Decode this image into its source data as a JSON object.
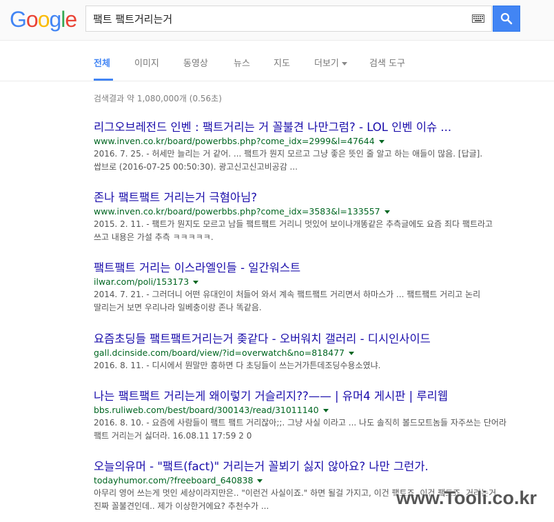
{
  "logo": {
    "letters": [
      "G",
      "o",
      "o",
      "g",
      "l",
      "e"
    ],
    "colors": [
      "#4285f4",
      "#ea4335",
      "#fbbc05",
      "#4285f4",
      "#34a853",
      "#ea4335"
    ]
  },
  "search": {
    "query": "퍀트 퍀트거리는거"
  },
  "tabs": [
    {
      "label": "전체",
      "active": true
    },
    {
      "label": "이미지"
    },
    {
      "label": "동영상"
    },
    {
      "label": "뉴스"
    },
    {
      "label": "지도"
    },
    {
      "label": "더보기"
    },
    {
      "label": "검색 도구"
    }
  ],
  "stats": "검색결과 약 1,080,000개 (0.56초)",
  "results": [
    {
      "title": "리그오브레전드 인벤 : 퍀트거리는 거 꼴불견 나만그럼? - LOL 인벤 이슈 ...",
      "url": "www.inven.co.kr/board/powerbbs.php?come_idx=2999&l=47644",
      "snippet": "2016. 7. 25. - 허세만 늘리는 거 같어. ... 퍀트가 뭔지 모르고 그냥 좋은 뜻인 줄 알고 하는 애들이 많음. [답글]. 쌉브로 (2016-07-25 00:50:30). 광고신고신고비공감 ..."
    },
    {
      "title": "존나 퍀트퍀트 거리는거 극혐아님?",
      "url": "www.inven.co.kr/board/powerbbs.php?come_idx=3583&l=133557",
      "snippet": "2015. 2. 11. - 퍀트가 뭔지도 모르고 남들 퍀트퍀트 거리니 멋있어 보이나개똥같은 추측글에도 요즘 죄다 퍀트라고 쓰고 내용은 가설 추측 ㅋㅋㅋㅋㅋ."
    },
    {
      "title": "퍀트퍀트 거리는 이스라엘인들 - 일간워스트",
      "url": "ilwar.com/poli/153173",
      "snippet": "2014. 7. 21. - 그러더니 어떤 유대인이 처들어 와서 계속 퍀트퍀트 거리면서 하마스가 ... 퍀트퍀트 거리고 논리 딸리는거 보면 우리나라 일베충이랑 존나 똑같음."
    },
    {
      "title": "요즘초딩들 퍀트퍀트거리는거 좆같다 - 오버워치 갤러리 - 디시인사이드",
      "url": "gall.dcinside.com/board/view/?id=overwatch&no=818477",
      "snippet": "2016. 8. 11. - 디시에서 뭔말만 흥하면 다 초딩들이 쓰는거가튼데조딩수용소였냐."
    },
    {
      "title": "나는 퍀트퍀트 거리는게 왜이렇기 거슬리지??—— | 유머4 게시판 | 루리웹",
      "url": "bbs.ruliweb.com/best/board/300143/read/31011140",
      "snippet": "2016. 8. 10. - 요즘에 사람들이 퍀트 퍀트 거리잖아;;. 그냥 사실 이라고 ... 나도 솔직히 볼드모트놈들 자주쓰는 단어라 퍀트 거리는거 싫더라. 16.08.11 17:59 2 0"
    },
    {
      "title": "오늘의유머 - \"퍀트(fact)\" 거리는거 꼴뵈기 싫지 않아요? 나만 그런가.",
      "url": "todayhumor.com/?freeboard_640838",
      "snippet": "아무리 영어 쓰는게 멋인 세상이라지만은.. \"이런건 사실이죠.\" 하면 될걸 가지고, 이건 퍀트죠. 이건 퍀트죠. 거리는거 진짜 꼴불견인데.. 제가 이상한거에요? 추천수가 ..."
    }
  ],
  "watermark": "www.Tooli.co.kr"
}
